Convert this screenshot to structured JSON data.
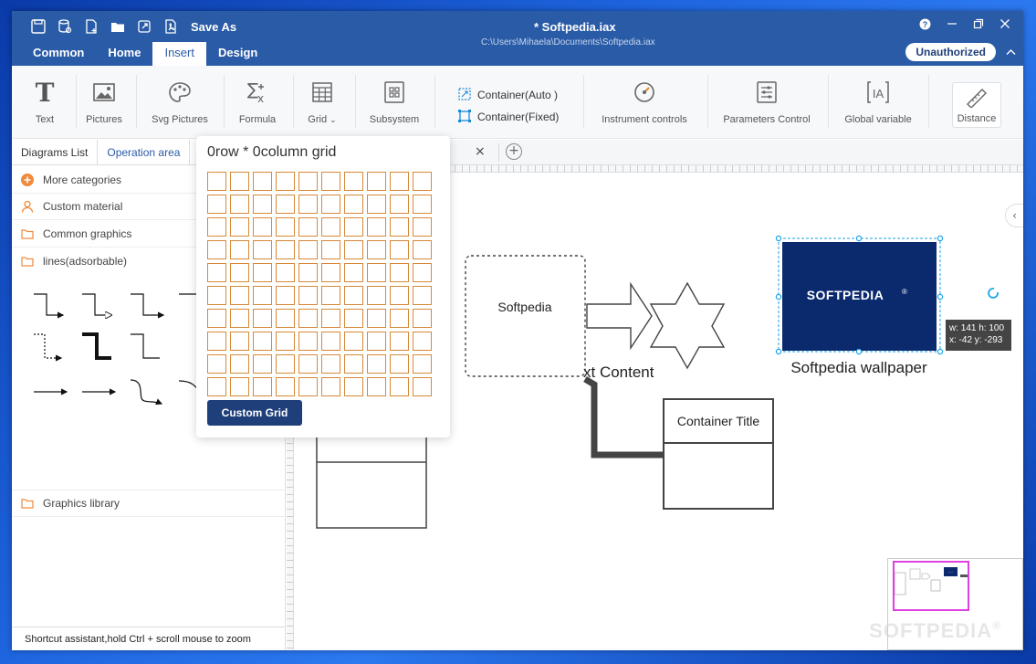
{
  "titlebar": {
    "save_as": "Save As",
    "doc_title": "*  Softpedia.iax",
    "doc_path": "C:\\Users\\Mihaela\\Documents\\Softpedia.iax",
    "tabs": [
      "Common",
      "Home",
      "Insert",
      "Design"
    ],
    "active_tab": "Insert",
    "unauthorized": "Unauthorized"
  },
  "ribbon": {
    "text": "Text",
    "pictures": "Pictures",
    "svg_pictures": "Svg Pictures",
    "formula": "Formula",
    "grid": "Grid",
    "subsystem": "Subsystem",
    "container_auto": "Container(Auto )",
    "container_fixed": "Container(Fixed)",
    "instrument_controls": "Instrument controls",
    "parameters_control": "Parameters Control",
    "global_variable": "Global variable",
    "distance": "Distance"
  },
  "left_panel": {
    "tabs": [
      "Diagrams List",
      "Operation area"
    ],
    "more_categories": "More categories",
    "custom_material": "Custom material",
    "common_graphics": "Common graphics",
    "lines_adsorbable": "lines(adsorbable)",
    "graphics_library": "Graphics library",
    "status": "Shortcut assistant,hold Ctrl + scroll mouse to zoom"
  },
  "grid_popup": {
    "title": "0row * 0column grid",
    "rows": 10,
    "cols": 10,
    "custom_grid": "Custom Grid"
  },
  "canvas": {
    "close_tab": "×",
    "add_tab": "+",
    "softpedia_box": "Softpedia",
    "text_content": "xt Content",
    "container_title": "Container Title",
    "logo_text": "SOFTPEDIA",
    "logo_mark": "®",
    "image_caption": "Softpedia wallpaper",
    "size_tip_line1": "w: 141  h: 100",
    "size_tip_line2": "x: -42  y: -293",
    "minimap_label": "····"
  },
  "watermark": "SOFTPEDIA",
  "watermark_mark": "®",
  "colors": {
    "titlebar": "#2a5ba6",
    "accent": "#1f3f7a",
    "grid_cell": "#d6893a",
    "logo_bg": "#0b2a6e",
    "selection": "#1aa3e8",
    "minimap_view": "#e040e0"
  }
}
